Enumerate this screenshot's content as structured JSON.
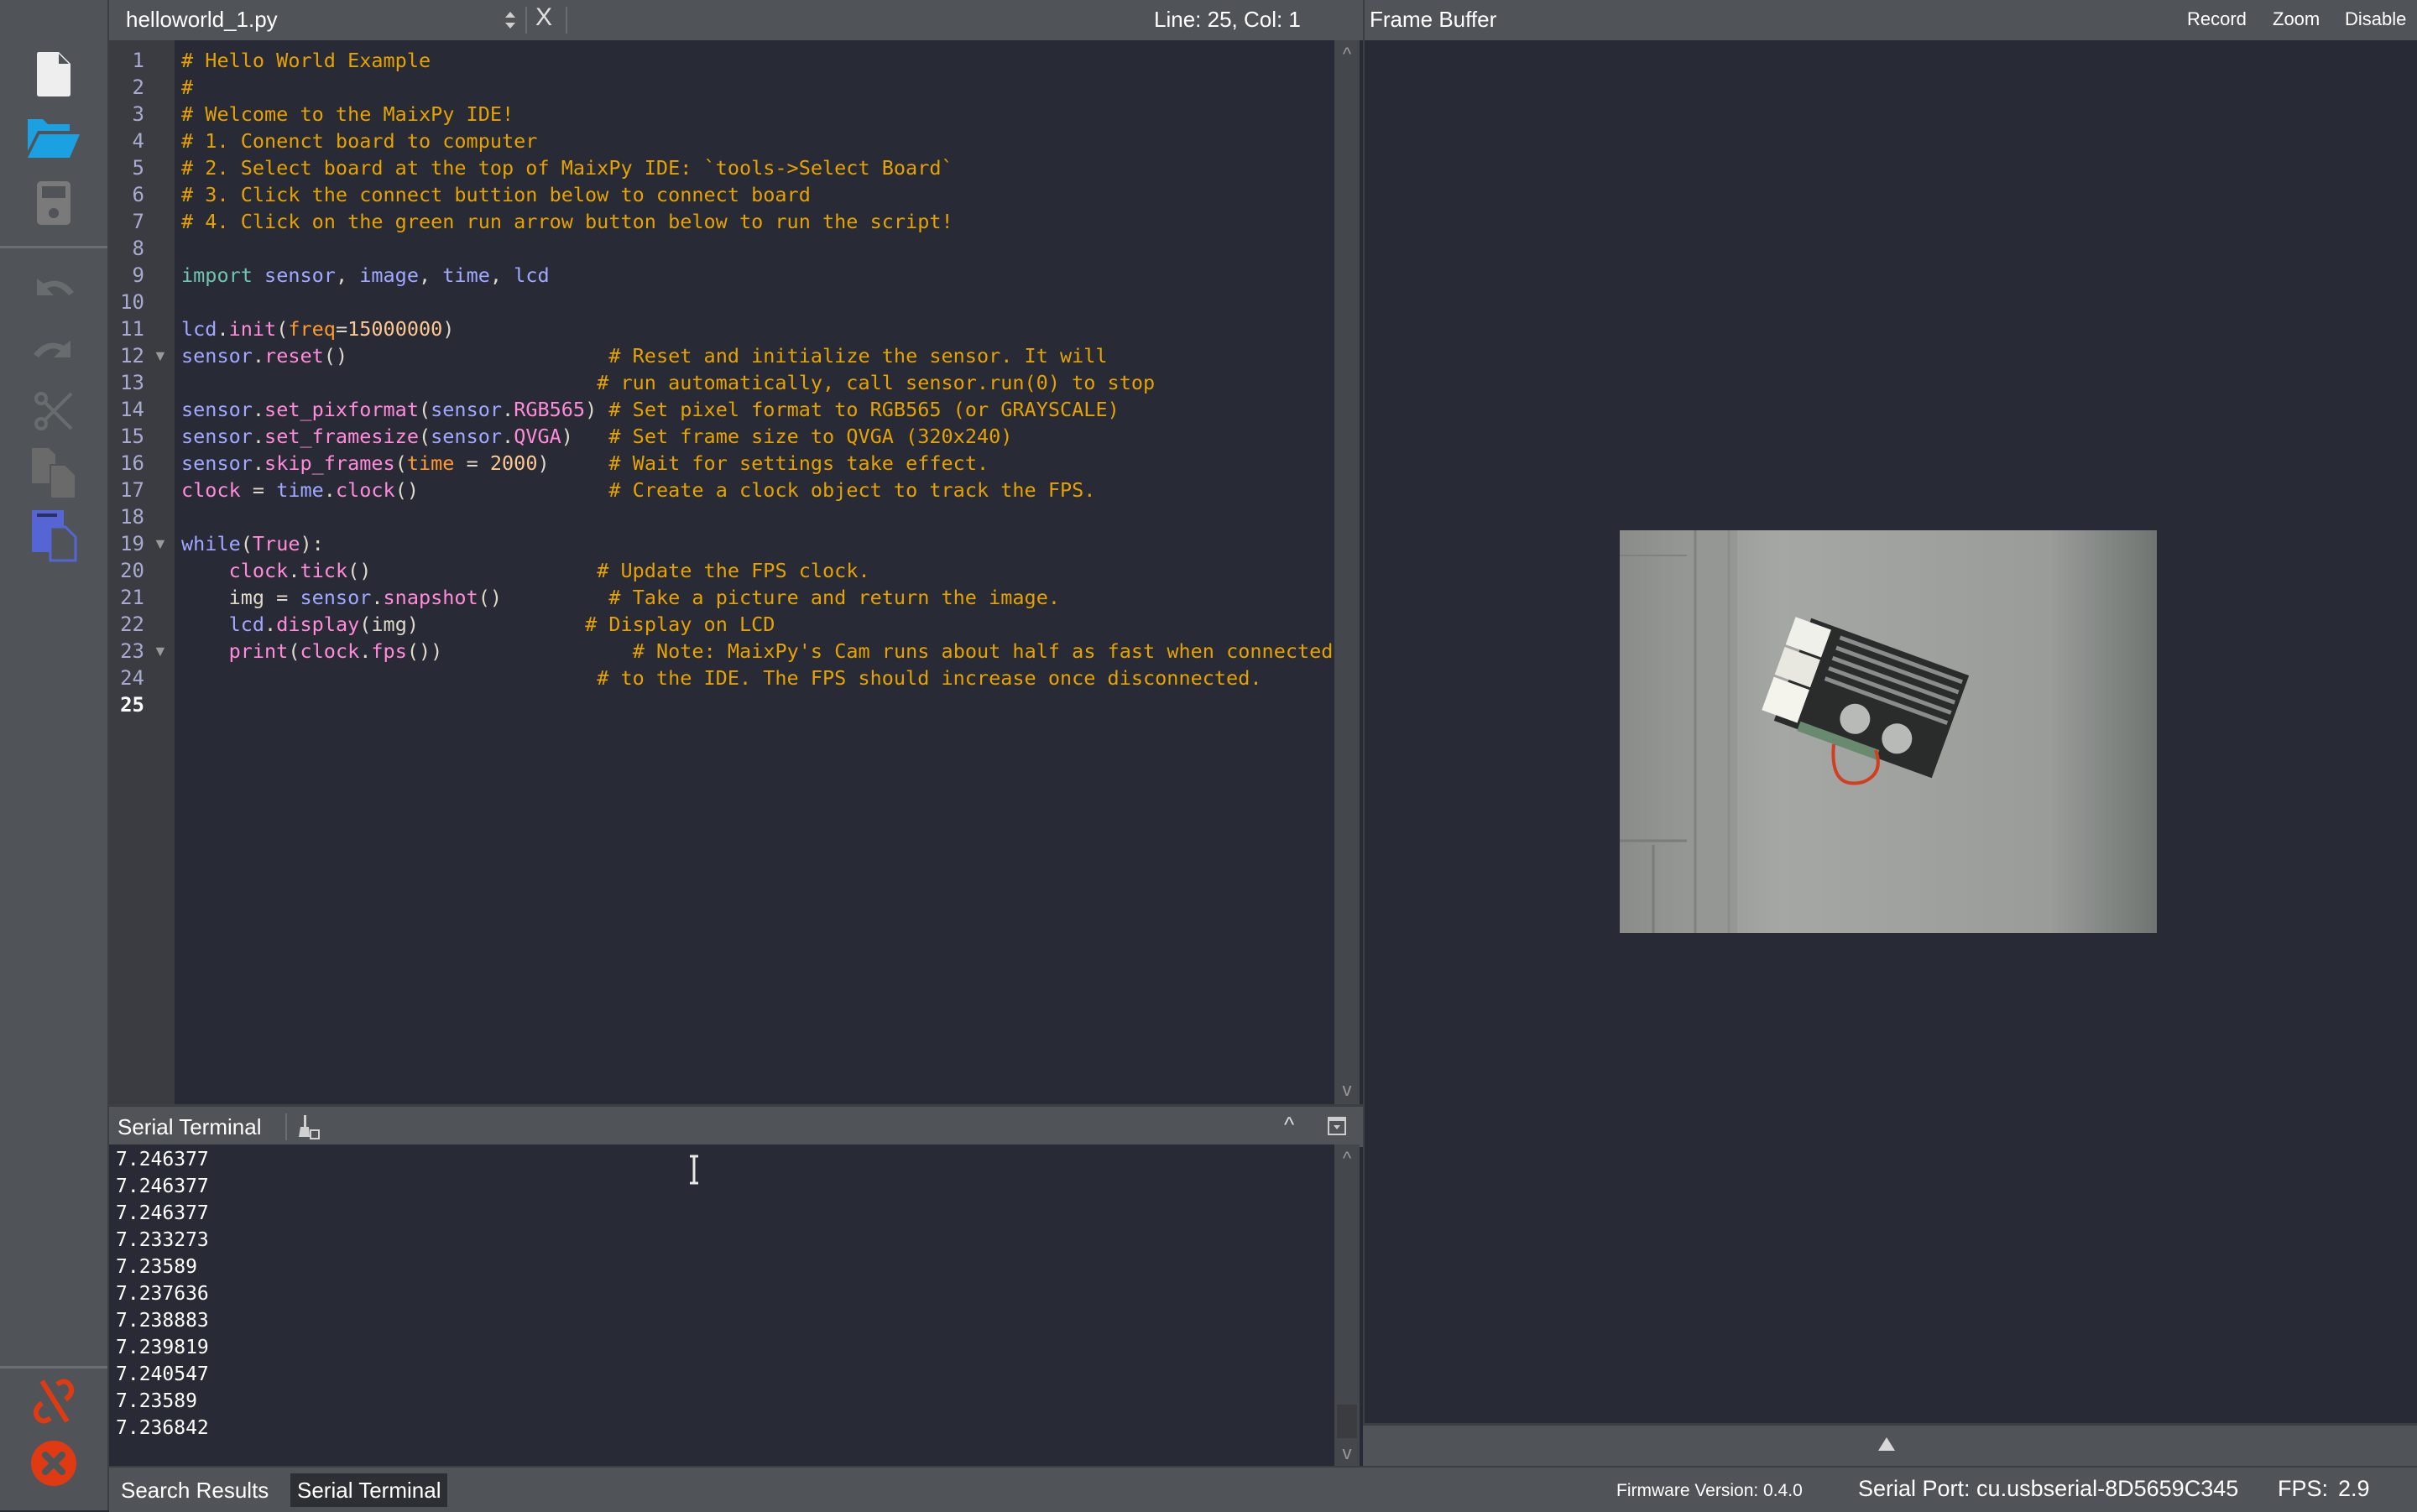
{
  "toolbar": {
    "items": [
      {
        "name": "new-file",
        "icon": "file-icon",
        "enabled": true
      },
      {
        "name": "open-file",
        "icon": "folder-open-icon",
        "enabled": true
      },
      {
        "name": "save-file",
        "icon": "save-icon",
        "enabled": false
      },
      {
        "name": "undo",
        "icon": "undo-icon",
        "enabled": false
      },
      {
        "name": "redo",
        "icon": "redo-icon",
        "enabled": false
      },
      {
        "name": "cut",
        "icon": "scissors-icon",
        "enabled": false
      },
      {
        "name": "copy",
        "icon": "copy-icon",
        "enabled": false
      },
      {
        "name": "paste",
        "icon": "paste-icon",
        "enabled": true
      },
      {
        "name": "disconnect",
        "icon": "unlink-icon",
        "enabled": true
      },
      {
        "name": "stop",
        "icon": "stop-icon",
        "enabled": true
      }
    ],
    "colors": {
      "accent_blue": "#1ba1e2",
      "paste_blue": "#5566d4",
      "danger": "#e03a12",
      "disabled": "#6e6e6e"
    }
  },
  "editor": {
    "file_name": "helloworld_1.py",
    "cursor_position": "Line: 25, Col: 1",
    "current_line": 25,
    "close_label": "X",
    "folded_lines": [
      12,
      19,
      23
    ],
    "lines": [
      [
        [
          "cm",
          "# Hello World Example"
        ]
      ],
      [
        [
          "cm",
          "#"
        ]
      ],
      [
        [
          "cm",
          "# Welcome to the MaixPy IDE!"
        ]
      ],
      [
        [
          "cm",
          "# 1. Conenct board to computer"
        ]
      ],
      [
        [
          "cm",
          "# 2. Select board at the top of MaixPy IDE: `tools->Select Board`"
        ]
      ],
      [
        [
          "cm",
          "# 3. Click the connect buttion below to connect board"
        ]
      ],
      [
        [
          "cm",
          "# 4. Click on the green run arrow button below to run the script!"
        ]
      ],
      [],
      [
        [
          "kw",
          "import"
        ],
        [
          "pn",
          " "
        ],
        [
          "id",
          "sensor"
        ],
        [
          "pn",
          ", "
        ],
        [
          "id",
          "image"
        ],
        [
          "pn",
          ", "
        ],
        [
          "id",
          "time"
        ],
        [
          "pn",
          ", "
        ],
        [
          "id",
          "lcd"
        ]
      ],
      [],
      [
        [
          "id",
          "lcd"
        ],
        [
          "pn",
          "."
        ],
        [
          "fn",
          "init"
        ],
        [
          "pn",
          "("
        ],
        [
          "pr",
          "freq"
        ],
        [
          "pn",
          "="
        ],
        [
          "nm",
          "15000000"
        ],
        [
          "pn",
          ")"
        ]
      ],
      [
        [
          "id",
          "sensor"
        ],
        [
          "pn",
          "."
        ],
        [
          "fn",
          "reset"
        ],
        [
          "pn",
          "()                      "
        ],
        [
          "cm",
          "# Reset and initialize the sensor. It will"
        ]
      ],
      [
        [
          "pn",
          "                                   "
        ],
        [
          "cm",
          "# run automatically, call sensor.run(0) to stop"
        ]
      ],
      [
        [
          "id",
          "sensor"
        ],
        [
          "pn",
          "."
        ],
        [
          "fn",
          "set_pixformat"
        ],
        [
          "pn",
          "("
        ],
        [
          "id",
          "sensor"
        ],
        [
          "pn",
          "."
        ],
        [
          "fn",
          "RGB565"
        ],
        [
          "pn",
          ") "
        ],
        [
          "cm",
          "# Set pixel format to RGB565 (or GRAYSCALE)"
        ]
      ],
      [
        [
          "id",
          "sensor"
        ],
        [
          "pn",
          "."
        ],
        [
          "fn",
          "set_framesize"
        ],
        [
          "pn",
          "("
        ],
        [
          "id",
          "sensor"
        ],
        [
          "pn",
          "."
        ],
        [
          "fn",
          "QVGA"
        ],
        [
          "pn",
          ")   "
        ],
        [
          "cm",
          "# Set frame size to QVGA (320x240)"
        ]
      ],
      [
        [
          "id",
          "sensor"
        ],
        [
          "pn",
          "."
        ],
        [
          "fn",
          "skip_frames"
        ],
        [
          "pn",
          "("
        ],
        [
          "pr",
          "time"
        ],
        [
          "pn",
          " = "
        ],
        [
          "nm",
          "2000"
        ],
        [
          "pn",
          ")     "
        ],
        [
          "cm",
          "# Wait for settings take effect."
        ]
      ],
      [
        [
          "fn",
          "clock"
        ],
        [
          "pn",
          " = "
        ],
        [
          "id",
          "time"
        ],
        [
          "pn",
          "."
        ],
        [
          "fn",
          "clock"
        ],
        [
          "pn",
          "()                "
        ],
        [
          "cm",
          "# Create a clock object to track the FPS."
        ]
      ],
      [],
      [
        [
          "id",
          "while"
        ],
        [
          "pn",
          "("
        ],
        [
          "fn",
          "True"
        ],
        [
          "pn",
          "):"
        ]
      ],
      [
        [
          "pn",
          "    "
        ],
        [
          "fn",
          "clock"
        ],
        [
          "pn",
          "."
        ],
        [
          "fn",
          "tick"
        ],
        [
          "pn",
          "()                   "
        ],
        [
          "cm",
          "# Update the FPS clock."
        ]
      ],
      [
        [
          "pn",
          "    img = "
        ],
        [
          "id",
          "sensor"
        ],
        [
          "pn",
          "."
        ],
        [
          "fn",
          "snapshot"
        ],
        [
          "pn",
          "()         "
        ],
        [
          "cm",
          "# Take a picture and return the image."
        ]
      ],
      [
        [
          "pn",
          "    "
        ],
        [
          "id",
          "lcd"
        ],
        [
          "pn",
          "."
        ],
        [
          "fn",
          "display"
        ],
        [
          "pn",
          "(img)              "
        ],
        [
          "cm",
          "# Display on LCD"
        ]
      ],
      [
        [
          "pn",
          "    "
        ],
        [
          "fn",
          "print"
        ],
        [
          "pn",
          "("
        ],
        [
          "fn",
          "clock"
        ],
        [
          "pn",
          "."
        ],
        [
          "fn",
          "fps"
        ],
        [
          "pn",
          "())                "
        ],
        [
          "cm",
          "# Note: MaixPy's Cam runs about half as fast when connected"
        ]
      ],
      [
        [
          "pn",
          "                                   "
        ],
        [
          "cm",
          "# to the IDE. The FPS should increase once disconnected."
        ]
      ],
      []
    ]
  },
  "frame_buffer": {
    "title": "Frame Buffer",
    "buttons": {
      "record": "Record",
      "zoom": "Zoom",
      "disable": "Disable"
    },
    "image_description": "Camera frame: board with heatsink on grey surface"
  },
  "serial_terminal": {
    "title": "Serial Terminal",
    "output": [
      "7.246377",
      "7.246377",
      "7.246377",
      "7.233273",
      "7.23589",
      "7.237636",
      "7.238883",
      "7.239819",
      "7.240547",
      "7.23589",
      "7.236842"
    ]
  },
  "bottom_tabs": [
    {
      "label": "Search Results",
      "active": false
    },
    {
      "label": "Serial Terminal",
      "active": true
    }
  ],
  "status_bar": {
    "firmware": "Firmware Version: 0.4.0",
    "serial_port": "Serial Port: cu.usbserial-8D5659C345",
    "fps_label": "FPS:",
    "fps_value": "2.9"
  }
}
